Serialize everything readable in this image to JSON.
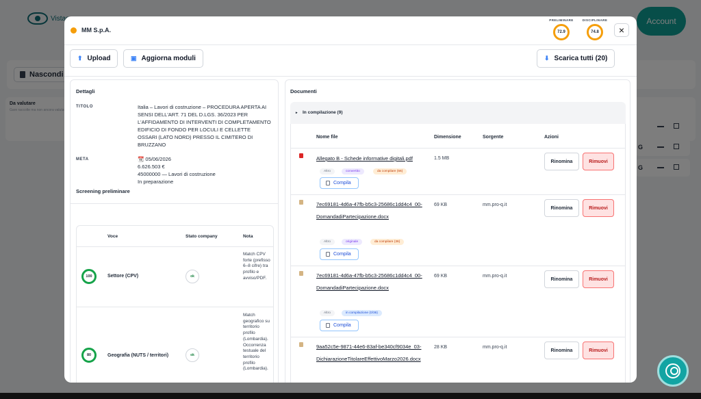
{
  "background": {
    "logo_text": "Vistage",
    "account_label": "Account",
    "hide_button": "Nascondi a",
    "card_title": "Da valutare",
    "card_subtitle": "Gare raccolte ma non ancora valutate",
    "rows": [
      "G",
      "",
      "G"
    ]
  },
  "modal": {
    "company": "MM S.p.A.",
    "status_color": "#f59e0b",
    "gauges": [
      {
        "label": "PRELIMINARE",
        "value": "72.9"
      },
      {
        "label": "DISCIPLINARE",
        "value": "74.8"
      }
    ],
    "close_icon": "×",
    "actions": {
      "upload": "Upload",
      "update_modules": "Aggiorna moduli",
      "download_all": "Scarica tutti (20)"
    },
    "details": {
      "section_title": "Dettagli",
      "titolo_label": "TITOLO",
      "titolo_value": "Italia – Lavori di costruzione – PROCEDURA APERTA AI SENSI DELL'ART. 71 DEL D.LGS. 36/2023 PER L'AFFIDAMENTO DI INTERVENTI DI COMPLETAMENTO EDIFICIO DI FONDO PER LOCULI E CELLETTE OSSARI (LATO NORD) PRESSO IL CIMITERO DI BRUZZANO",
      "meta_label": "META",
      "meta_date": "📆 05/06/2026",
      "meta_amount": "6.626.503 €",
      "meta_cpv": "45000000 — Lavori di costruzione",
      "meta_status": "In preparazione"
    },
    "screening": {
      "section_title": "Screening preliminare",
      "headers": [
        "Voce",
        "Stato company",
        "Nota"
      ],
      "rows": [
        {
          "score": "100",
          "voce": "Settore (CPV)",
          "stato": "ok",
          "nota": "Match CPV forte (prefisso 6–8 cifre) tra profilo e avviso/PDF."
        },
        {
          "score": "80",
          "voce": "Geografia (NUTS / territori)",
          "stato": "ok",
          "nota": "Match geografico su territorio profilo (Lombardia). Occorrenza testuale del territorio profilo (Lombardia)."
        }
      ]
    },
    "documents": {
      "section_title": "Documenti",
      "group_label": "In compilazione (9)",
      "headers": [
        "Nome file",
        "Dimensione",
        "Sorgente",
        "Azioni"
      ],
      "rename_label": "Rinomina",
      "remove_label": "Rimuovi",
      "compile_label": "Compila",
      "files": [
        {
          "name": "Allegato B - Schede informative digitali.pdf",
          "size": "1.5 MB",
          "source": "",
          "tags": [
            "Altro",
            "convertito",
            "da compilare (56)"
          ]
        },
        {
          "name": "7ec69181-4d6a-47fb-b5c3-25686c1dd4c4_00-DomandadiPartecipazione.docx",
          "size": "69 KB",
          "source": "mm.pro-q.it",
          "tags": [
            "Altro",
            "originale",
            "da compilare (36)"
          ]
        },
        {
          "name": "7ec69181-4d6a-47fb-b5c3-25686c1dd4c4_00-DomandadiPartecipazione.docx",
          "size": "69 KB",
          "source": "mm.pro-q.it",
          "tags": [
            "Altro",
            "in compilazione (0/36)"
          ]
        },
        {
          "name": "9aa52c5e-9871-44e6-83af-be340cf9034e_03-DichiarazioneTitolareEffettivoMarzo2026.docx",
          "size": "28 KB",
          "source": "mm.pro-q.it",
          "tags": []
        }
      ]
    }
  }
}
